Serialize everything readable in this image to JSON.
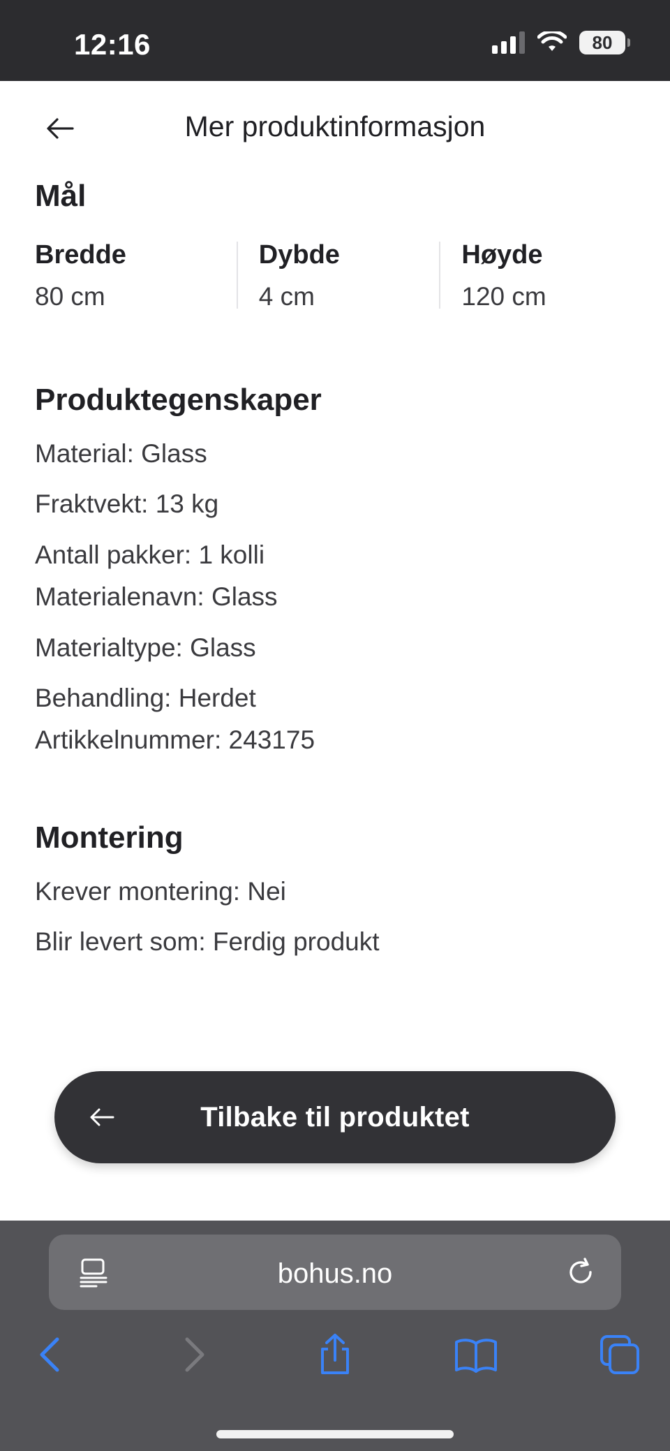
{
  "status_bar": {
    "time": "12:16",
    "battery": "80"
  },
  "header": {
    "title": "Mer produktinformasjon"
  },
  "dimensions": {
    "title": "Mål",
    "items": [
      {
        "label": "Bredde",
        "value": "80 cm"
      },
      {
        "label": "Dybde",
        "value": "4 cm"
      },
      {
        "label": "Høyde",
        "value": "120 cm"
      }
    ]
  },
  "properties": {
    "title": "Produktegenskaper",
    "items": [
      "Material: Glass",
      "Fraktvekt: 13 kg",
      "Antall pakker: 1 kolli",
      "Materialenavn: Glass",
      "Materialtype: Glass",
      "Behandling: Herdet",
      "Artikkelnummer: 243175"
    ]
  },
  "mounting": {
    "title": "Montering",
    "items": [
      "Krever montering: Nei",
      "Blir levert som: Ferdig produkt"
    ]
  },
  "cta": {
    "label": "Tilbake til produktet"
  },
  "browser": {
    "url": "bohus.no"
  },
  "colors": {
    "accent": "#3a82f7",
    "cta_bg": "#323236",
    "status_bg": "#2c2c2f"
  }
}
